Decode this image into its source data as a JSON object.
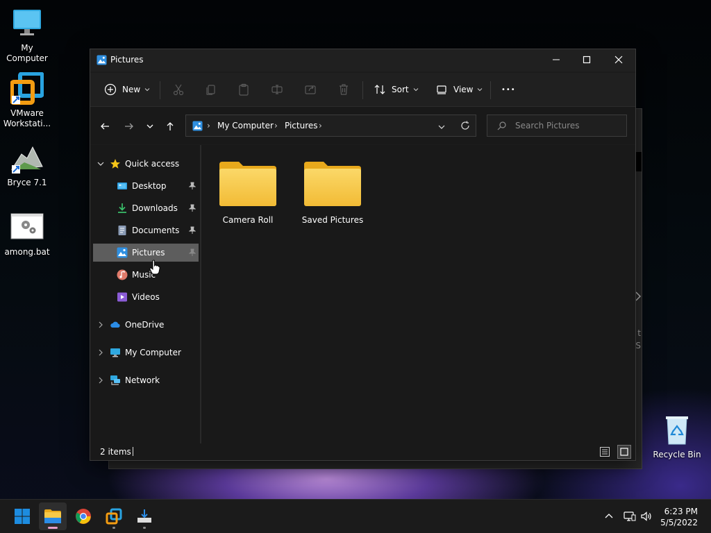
{
  "desktop": {
    "icons": [
      {
        "label": "My Computer"
      },
      {
        "label": "VMware Workstati..."
      },
      {
        "label": "Bryce 7.1"
      },
      {
        "label": "among.bat"
      },
      {
        "label": "Recycle Bin"
      }
    ],
    "background_fragments": [
      "t",
      "S"
    ]
  },
  "window": {
    "title": "Pictures",
    "controls": {
      "minimize": "—",
      "maximize": "☐",
      "close": "✕"
    }
  },
  "toolbar": {
    "new_label": "New",
    "sort_label": "Sort",
    "view_label": "View",
    "more_label": "•••"
  },
  "address": {
    "crumbs": [
      "My Computer",
      "Pictures"
    ],
    "separator": "›"
  },
  "search": {
    "placeholder": "Search Pictures"
  },
  "sidebar": {
    "quick_access": "Quick access",
    "items": [
      {
        "label": "Desktop",
        "pinned": true
      },
      {
        "label": "Downloads",
        "pinned": true
      },
      {
        "label": "Documents",
        "pinned": true
      },
      {
        "label": "Pictures",
        "pinned": true,
        "selected": true
      },
      {
        "label": "Music"
      },
      {
        "label": "Videos"
      }
    ],
    "roots": [
      {
        "label": "OneDrive"
      },
      {
        "label": "My Computer"
      },
      {
        "label": "Network"
      }
    ]
  },
  "content": {
    "folders": [
      {
        "label": "Camera Roll"
      },
      {
        "label": "Saved Pictures"
      }
    ]
  },
  "status": {
    "count": "2 items"
  },
  "taskbar": {
    "clock_time": "6:23 PM",
    "clock_date": "5/5/2022"
  },
  "colors": {
    "folder": "#f7c948",
    "accent": "#0078d4",
    "selection": "#5d5d5d"
  }
}
